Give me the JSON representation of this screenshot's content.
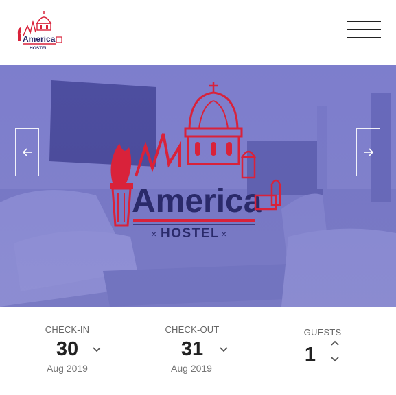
{
  "header": {
    "logo_text": "America",
    "logo_subtext": "HOSTEL",
    "menu_icon": "hamburger-menu-icon"
  },
  "hero": {
    "logo_text": "America",
    "logo_subtext": "HOSTEL",
    "prev_icon": "arrow-left-icon",
    "next_icon": "arrow-right-icon",
    "overlay_color": "#4646be"
  },
  "booking": {
    "checkin": {
      "label": "CHECK-IN",
      "day": "30",
      "month_year": "Aug 2019"
    },
    "checkout": {
      "label": "CHECK-OUT",
      "day": "31",
      "month_year": "Aug 2019"
    },
    "guests": {
      "label": "GUESTS",
      "count": "1"
    }
  },
  "colors": {
    "brand_red": "#d9223a",
    "brand_navy": "#2a2a6a"
  }
}
